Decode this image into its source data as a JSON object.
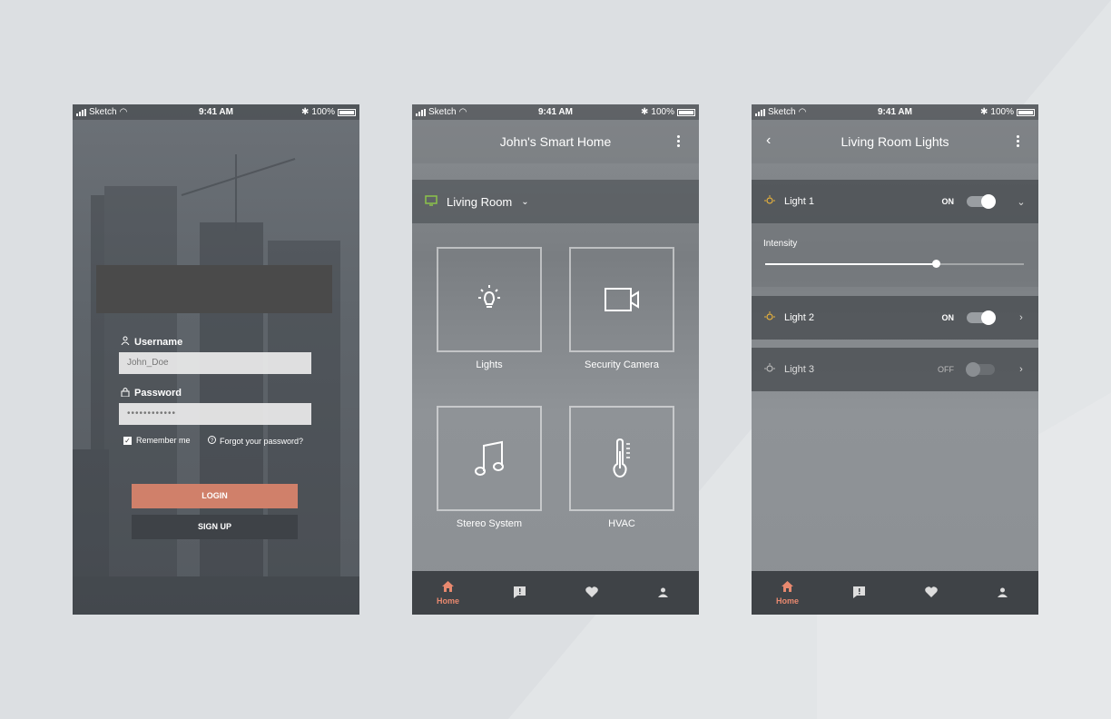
{
  "status_bar": {
    "carrier": "Sketch",
    "time": "9:41 AM",
    "battery": "100%"
  },
  "login": {
    "username_label": "Username",
    "username_value": "John_Doe",
    "password_label": "Password",
    "password_value": "••••••••••••",
    "remember_label": "Remember me",
    "remember_checked": true,
    "forgot_label": "Forgot your password?",
    "login_button": "LOGIN",
    "signup_button": "SIGN UP"
  },
  "home": {
    "title": "John's Smart Home",
    "room": "Living Room",
    "tiles": [
      {
        "label": "Lights",
        "icon": "bulb-icon"
      },
      {
        "label": "Security Camera",
        "icon": "camera-icon"
      },
      {
        "label": "Stereo System",
        "icon": "music-icon"
      },
      {
        "label": "HVAC",
        "icon": "thermometer-icon"
      }
    ]
  },
  "lights": {
    "title": "Living Room Lights",
    "intensity_label": "Intensity",
    "intensity_fraction": 0.66,
    "items": [
      {
        "name": "Light 1",
        "state": "ON",
        "expanded": true
      },
      {
        "name": "Light 2",
        "state": "ON",
        "expanded": false
      },
      {
        "name": "Light 3",
        "state": "OFF",
        "expanded": false
      }
    ]
  },
  "tabbar": {
    "home_label": "Home",
    "icons": [
      "home-icon",
      "alert-icon",
      "heart-icon",
      "user-icon"
    ]
  },
  "colors": {
    "accent": "#e8896f",
    "login_button": "#d0806a",
    "light_on": "#e8b23c",
    "room_icon": "#8bc34a"
  }
}
